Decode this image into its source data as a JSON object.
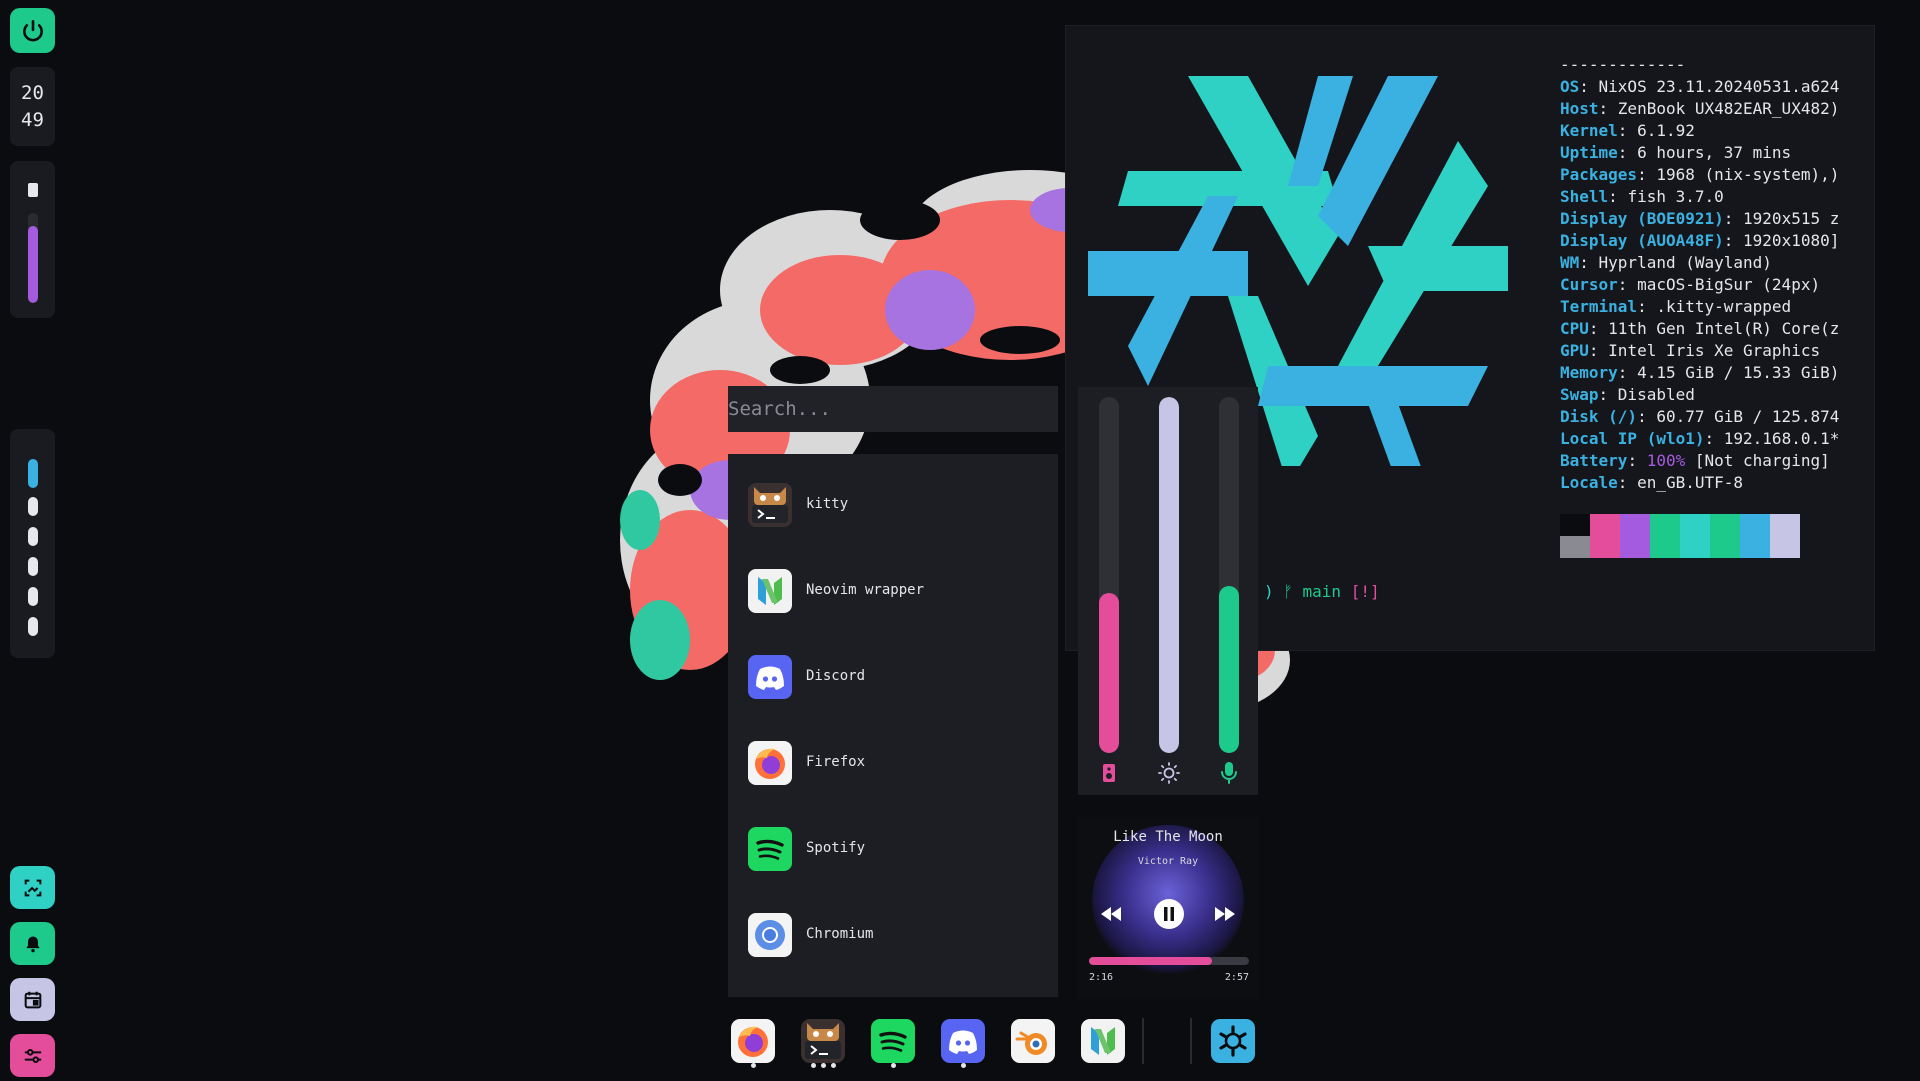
{
  "clock": {
    "hours": "20",
    "minutes": "49"
  },
  "battery": {
    "level": 0.86,
    "color": "#a55be0"
  },
  "workspaces": {
    "count": 6,
    "active": 1,
    "active_color": "#3ab1e0"
  },
  "quick_actions": [
    {
      "icon": "screenshot-icon",
      "color": "#2fd1c5"
    },
    {
      "icon": "bell-icon",
      "color": "#1ec98c"
    },
    {
      "icon": "calendar-icon",
      "color": "#c6c5e6"
    },
    {
      "icon": "sliders-icon",
      "color": "#e34d9a"
    }
  ],
  "launcher": {
    "search_placeholder": "Search...",
    "apps": [
      {
        "name": "kitty",
        "icon": "kitty-icon"
      },
      {
        "name": "Neovim wrapper",
        "icon": "neovim-icon"
      },
      {
        "name": "Discord",
        "icon": "discord-icon"
      },
      {
        "name": "Firefox",
        "icon": "firefox-icon"
      },
      {
        "name": "Spotify",
        "icon": "spotify-icon"
      },
      {
        "name": "Chromium",
        "icon": "chromium-icon"
      }
    ]
  },
  "sliders": [
    {
      "name": "volume",
      "icon": "speaker-icon",
      "level": 0.45,
      "color": "#e34d9a"
    },
    {
      "name": "brightness",
      "icon": "sun-icon",
      "level": 1.0,
      "color": "#c6c5e6"
    },
    {
      "name": "microphone",
      "icon": "microphone-icon",
      "level": 0.47,
      "color": "#1ec98c"
    }
  ],
  "media": {
    "title": "Like The Moon",
    "artist": "Victor Ray",
    "elapsed": "2:16",
    "duration": "2:57",
    "progress": 0.77
  },
  "neofetch": {
    "separator": "-------------",
    "rows": [
      {
        "key": "OS",
        "value": ": NixOS 23.11.20240531.a624"
      },
      {
        "key": "Host",
        "value": ": ZenBook UX482EAR_UX482)"
      },
      {
        "key": "Kernel",
        "value": ": 6.1.92"
      },
      {
        "key": "Uptime",
        "value": ": 6 hours, 37 mins"
      },
      {
        "key": "Packages",
        "value": ": 1968 (nix-system),)"
      },
      {
        "key": "Shell",
        "value": ": fish 3.7.0"
      },
      {
        "key": "Display (BOE0921)",
        "value": ": 1920x515 z"
      },
      {
        "key": "Display (AUOA48F)",
        "value": ": 1920x1080]"
      },
      {
        "key": "WM",
        "value": ": Hyprland (Wayland)"
      },
      {
        "key": "Cursor",
        "value": ": macOS-BigSur (24px)"
      },
      {
        "key": "Terminal",
        "value": ": .kitty-wrapped"
      },
      {
        "key": "CPU",
        "value": ": 11th Gen Intel(R) Core(z"
      },
      {
        "key": "GPU",
        "value": ": Intel Iris Xe Graphics"
      },
      {
        "key": "Memory",
        "value": ": 4.15 GiB / 15.33 GiB)"
      },
      {
        "key": "Swap",
        "value": ": Disabled"
      },
      {
        "key": "Disk (/)",
        "value": ": 60.77 GiB / 125.874"
      },
      {
        "key": "Local IP (wlo1)",
        "value": ": 192.168.0.1*"
      }
    ],
    "battery_key": "Battery",
    "battery_pct": "100%",
    "battery_rest": " [Not charging]",
    "locale_key": "Locale",
    "locale_value": ": en_GB.UTF-8",
    "palette": [
      "#0b0c0f",
      "#e34d9a",
      "#a55be0",
      "#1ec98c",
      "#2fd1c5",
      "#1ec98c",
      "#3ab1e0",
      "#c6c5e6"
    ],
    "prompt_branch_icon": "ᚠ",
    "prompt_branch": "main",
    "prompt_flag": "[!]"
  },
  "dock": [
    {
      "icon": "firefox-icon",
      "dots": 1
    },
    {
      "icon": "kitty-icon",
      "dots": 3
    },
    {
      "icon": "spotify-icon",
      "dots": 1
    },
    {
      "icon": "discord-icon",
      "dots": 1
    },
    {
      "icon": "blender-icon",
      "dots": 0
    },
    {
      "icon": "neovim-icon",
      "dots": 0
    },
    {
      "icon": "nixos-settings-icon",
      "dots": 0
    }
  ]
}
